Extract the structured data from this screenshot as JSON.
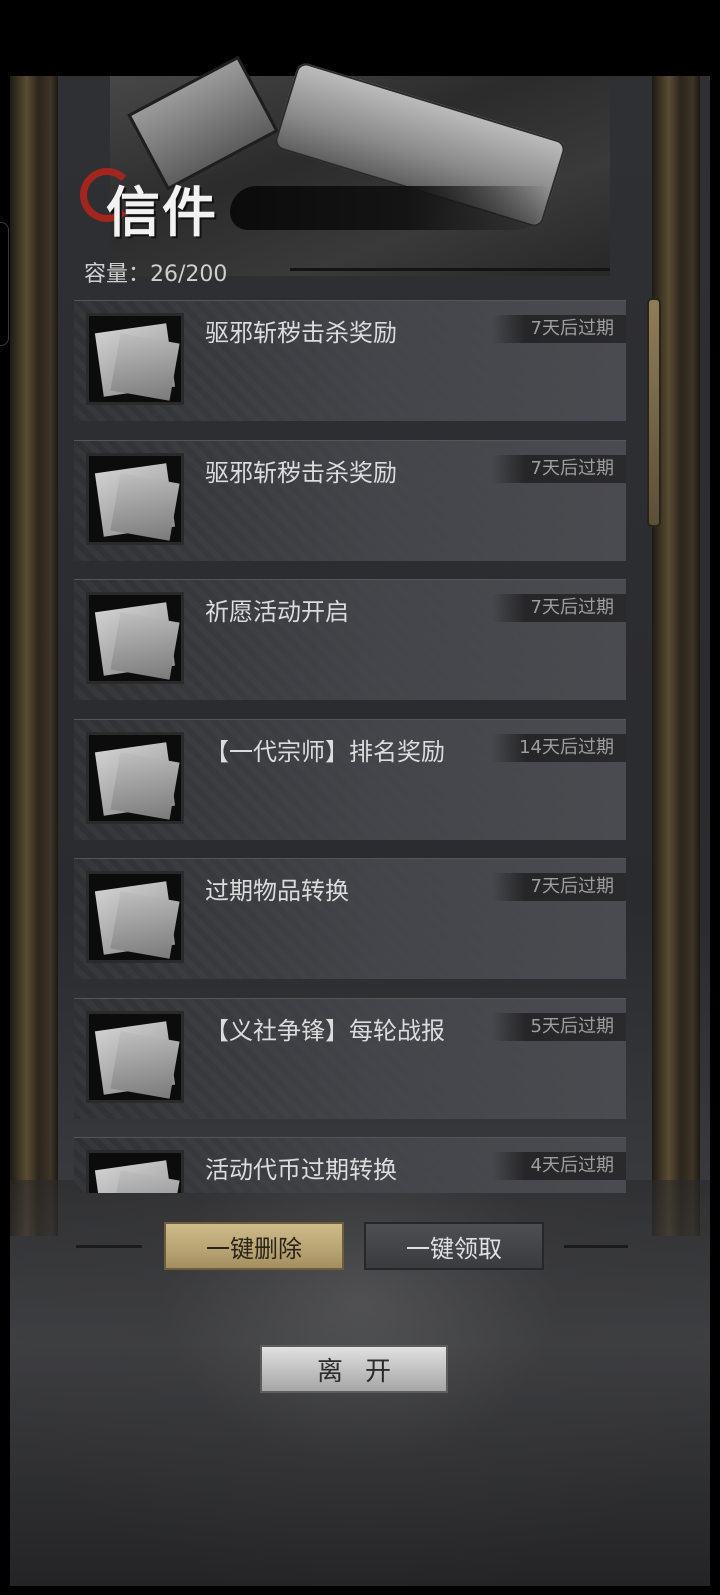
{
  "header": {
    "title": "信件",
    "capacity_label": "容量：26/200"
  },
  "mails": [
    {
      "title": "驱邪斩秽击杀奖励",
      "expiry": "7天后过期"
    },
    {
      "title": "驱邪斩秽击杀奖励",
      "expiry": "7天后过期"
    },
    {
      "title": "祈愿活动开启",
      "expiry": "7天后过期"
    },
    {
      "title": "【一代宗师】排名奖励",
      "expiry": "14天后过期"
    },
    {
      "title": "过期物品转换",
      "expiry": "7天后过期"
    },
    {
      "title": "【义社争锋】每轮战报",
      "expiry": "5天后过期"
    },
    {
      "title": "活动代币过期转换",
      "expiry": "4天后过期"
    }
  ],
  "actions": {
    "delete_all": "一键删除",
    "claim_all": "一键领取",
    "leave": "离开"
  },
  "colors": {
    "accent_gold": "#cdbb8a",
    "title_ring": "#a2261d"
  }
}
